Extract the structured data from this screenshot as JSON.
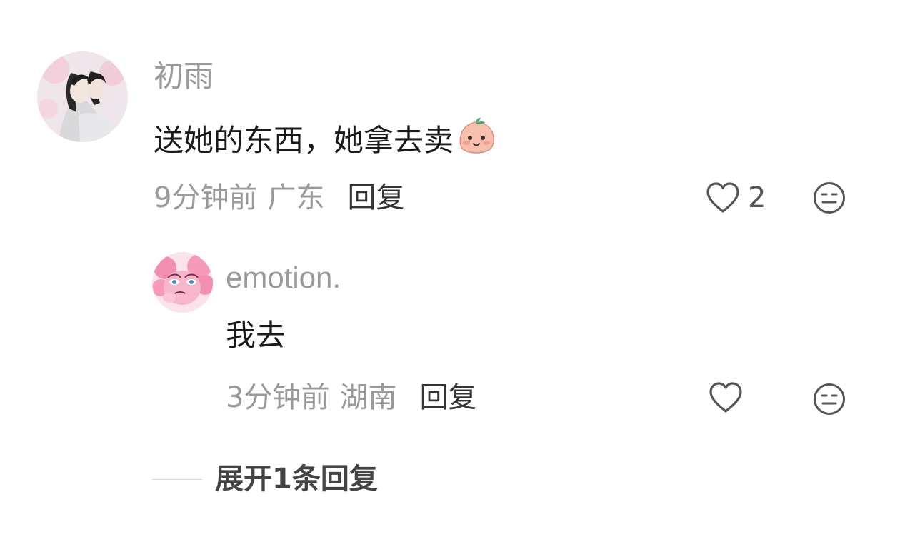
{
  "comments": [
    {
      "username": "初雨",
      "text": "送她的东西，她拿去卖",
      "emoji": "blush-face-emoji",
      "time": "9分钟前",
      "location": "广东",
      "reply_label": "回复",
      "like_count": "2",
      "like_icon": "heart-outline-icon",
      "dislike_icon": "meh-face-icon"
    },
    {
      "username": "emotion.",
      "text": "我去",
      "time": "3分钟前",
      "location": "湖南",
      "reply_label": "回复",
      "like_icon": "heart-outline-icon",
      "dislike_icon": "meh-face-icon"
    }
  ],
  "expand_replies_label": "展开1条回复",
  "colors": {
    "meta_gray": "#9a9a9a",
    "text_dark": "#1a1a1a",
    "icon_gray": "#555555",
    "emoji_peach": "#f6c0ad",
    "emoji_leaf": "#49b37a"
  }
}
